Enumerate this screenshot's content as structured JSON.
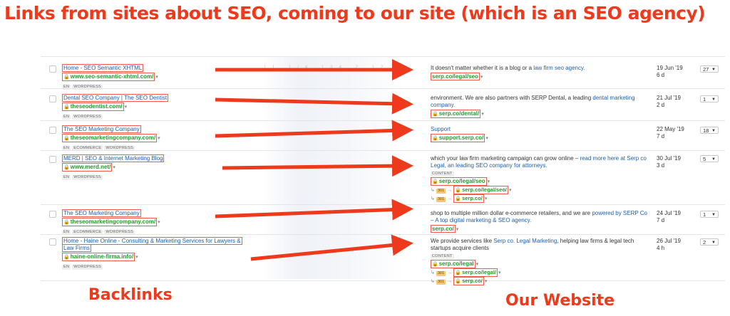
{
  "headline": "Links from sites about SEO, coming to our site (which is an SEO agency)",
  "footer": {
    "left": "Backlinks",
    "right": "Our Website"
  },
  "blur_text": "11 1/4 134 2 12",
  "rows": [
    {
      "title": "Home - SEO Semantic XHTML",
      "domain": "www.seo-semantic-xhtml.com/",
      "tags": [
        "EN",
        "WORDPRESS"
      ],
      "context": "It doesn't matter whether it is a blog or a",
      "anchor": "law firm seo agency.",
      "context_after": "",
      "show_content_tag": false,
      "target_url": "serp.co/legal/seo",
      "redirects": [],
      "date": "19 Jun '19",
      "age": "6 d",
      "count": "27"
    },
    {
      "title": "Dental SEO Company | The SEO Dentist",
      "domain": "theseodentist.com/",
      "tags": [
        "EN",
        "WORDPRESS"
      ],
      "context": "environment. We are also partners with SERP Dental, a leading",
      "anchor": "dental marketing company.",
      "context_after": "",
      "show_content_tag": false,
      "target_url": "serp.co/dental/",
      "redirects": [],
      "date": "21 Jul '19",
      "age": "2 d",
      "count": "1"
    },
    {
      "title": "The SEO Marketing Company",
      "domain": "theseomarketingcompany.com/",
      "tags": [
        "EN",
        "ECOMMERCE",
        "WORDPRESS"
      ],
      "context": "",
      "anchor": "Support",
      "context_after": "",
      "show_content_tag": false,
      "target_url": "support.serp.co/",
      "redirects": [],
      "date": "22 May '19",
      "age": "7 d",
      "count": "18"
    },
    {
      "title": "MERD | SEO & Internet Marketing Blog",
      "domain": "www.merd.net/",
      "tags": [
        "EN",
        "WORDPRESS"
      ],
      "context": "which your law firm marketing campaign can grow online –",
      "anchor": "read more here at Serp co Legal, an leading SEO company for attorneys.",
      "context_after": "",
      "show_content_tag": true,
      "content_tag": "CONTENT",
      "target_url": "serp.co/legal/seo",
      "redirects": [
        {
          "code": "301",
          "url": "serp.co/legal/seo/"
        },
        {
          "code": "301",
          "url": "serp.co/"
        }
      ],
      "date": "30 Jul '19",
      "age": "3 d",
      "count": "5"
    },
    {
      "title": "The SEO Marketing Company",
      "domain": "theseomarketingcompany.com/",
      "tags": [
        "EN",
        "ECOMMERCE",
        "WORDPRESS"
      ],
      "context": "shop to multiple million dollar e-commerce retailers, and we are",
      "anchor": "powered by SERP Co – A top digital marketing & SEO agency.",
      "context_after": "",
      "show_content_tag": false,
      "target_url": "serp.co/",
      "redirects": [],
      "date": "24 Jul '19",
      "age": "7 d",
      "count": "1"
    },
    {
      "title": "Home - Haine Online - Consulting & Marketing Services for Lawyers & Law Firms",
      "domain": "haine-online-firma.info/",
      "tags": [
        "EN",
        "WORDPRESS"
      ],
      "context": "We provide services like",
      "anchor": "Serp co. Legal Marketing,",
      "context_after": "helping law firms & legal tech startups acquire clients",
      "show_content_tag": true,
      "content_tag": "CONTENT",
      "target_url": "serp.co/legal",
      "redirects": [
        {
          "code": "301",
          "url": "serp.co/legal/"
        },
        {
          "code": "301",
          "url": "serp.co/"
        }
      ],
      "date": "26 Jul '19",
      "age": "4 h",
      "count": "2"
    }
  ],
  "colors": {
    "accent_red": "#ee3a1c",
    "link_blue": "#1f5fa8",
    "domain_green": "#229a2b"
  }
}
